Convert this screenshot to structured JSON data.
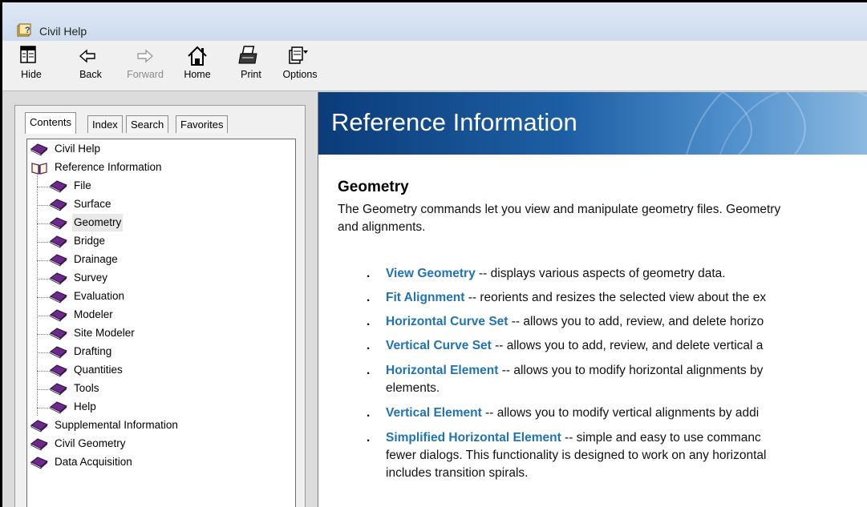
{
  "window": {
    "title": "Civil Help",
    "title_icon": "help-book-icon"
  },
  "toolbar": {
    "buttons": [
      {
        "label": "Hide",
        "icon": "hide-pane-icon",
        "enabled": true
      },
      {
        "label": "Back",
        "icon": "back-arrow-icon",
        "enabled": true
      },
      {
        "label": "Forward",
        "icon": "forward-arrow-icon",
        "enabled": false
      },
      {
        "label": "Home",
        "icon": "home-icon",
        "enabled": true
      },
      {
        "label": "Print",
        "icon": "printer-icon",
        "enabled": true
      },
      {
        "label": "Options",
        "icon": "options-icon",
        "enabled": true
      }
    ]
  },
  "nav": {
    "tabs": [
      "Contents",
      "Index",
      "Search",
      "Favorites"
    ],
    "active_tab": "Contents",
    "tree": [
      {
        "label": "Civil Help",
        "icon": "closed-book-icon"
      },
      {
        "label": "Reference Information",
        "icon": "open-book-icon"
      },
      {
        "label": "File",
        "icon": "closed-book-icon"
      },
      {
        "label": "Surface",
        "icon": "closed-book-icon"
      },
      {
        "label": "Geometry",
        "icon": "closed-book-icon",
        "selected": true
      },
      {
        "label": "Bridge",
        "icon": "closed-book-icon"
      },
      {
        "label": "Drainage",
        "icon": "closed-book-icon"
      },
      {
        "label": "Survey",
        "icon": "closed-book-icon"
      },
      {
        "label": "Evaluation",
        "icon": "closed-book-icon"
      },
      {
        "label": "Modeler",
        "icon": "closed-book-icon"
      },
      {
        "label": "Site Modeler",
        "icon": "closed-book-icon"
      },
      {
        "label": "Drafting",
        "icon": "closed-book-icon"
      },
      {
        "label": "Quantities",
        "icon": "closed-book-icon"
      },
      {
        "label": "Tools",
        "icon": "closed-book-icon"
      },
      {
        "label": "Help",
        "icon": "closed-book-icon"
      },
      {
        "label": "Supplemental Information",
        "icon": "closed-book-icon"
      },
      {
        "label": "Civil Geometry",
        "icon": "closed-book-icon"
      },
      {
        "label": "Data Acquisition",
        "icon": "closed-book-icon"
      }
    ]
  },
  "page": {
    "banner_title": "Reference Information",
    "heading": "Geometry",
    "intro_line1": "The Geometry commands let you view and manipulate geometry files. Geometry",
    "intro_line2": "and alignments.",
    "commands": [
      {
        "link": "View Geometry",
        "desc": " -- displays various aspects of geometry data."
      },
      {
        "link": "Fit Alignment",
        "desc": " -- reorients and resizes the selected view about the ex"
      },
      {
        "link": "Horizontal Curve Set",
        "desc": " -- allows you to add, review, and delete horizo"
      },
      {
        "link": "Vertical Curve Set",
        "desc": " -- allows you to add, review, and delete vertical a"
      },
      {
        "link": "Horizontal Element",
        "desc": " -- allows you to modify horizontal alignments by",
        "cont": "elements."
      },
      {
        "link": "Vertical Element",
        "desc": " -- allows you to modify vertical alignments by addi"
      },
      {
        "link": "Simplified Horizontal Element",
        "desc": " -- simple and easy to use commanc",
        "cont": "fewer dialogs. This functionality is designed to work on any horizontal",
        "cont2": "includes transition spirals."
      }
    ]
  },
  "colors": {
    "link": "#1f73b4",
    "banner": "#1d5fa4",
    "book": "#6b2a8a"
  }
}
